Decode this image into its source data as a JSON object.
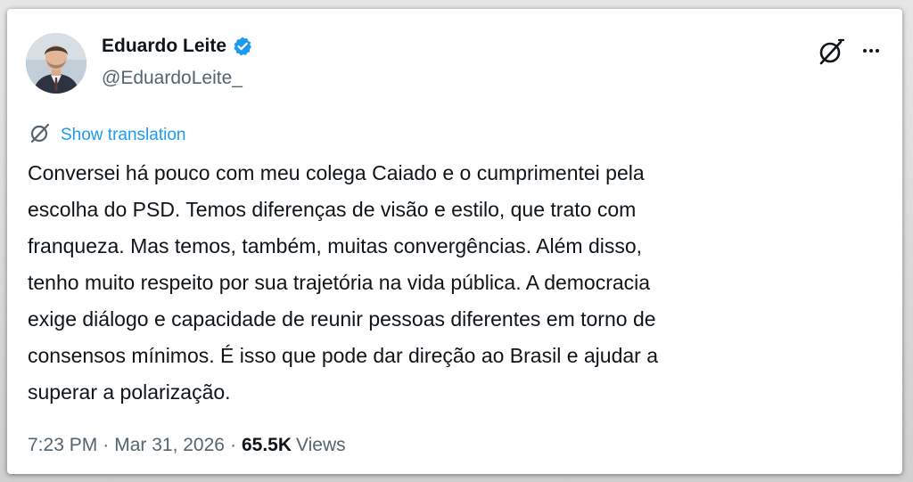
{
  "author": {
    "name": "Eduardo Leite",
    "handle": "@EduardoLeite_",
    "verified_icon": "verified-badge-icon",
    "verified_color": "#1d9bf0"
  },
  "actions": {
    "grok_icon": "grok-icon",
    "more_icon": "more-options-icon"
  },
  "translation": {
    "icon": "translate-icon",
    "label": "Show translation"
  },
  "tweet": {
    "text": "Conversei há pouco com meu colega Caiado e o cumprimentei pela\nescolha do PSD. Temos diferenças de visão e estilo, que trato com\nfranqueza. Mas temos, também, muitas convergências. Além disso,\ntenho muito respeito por sua trajetória na vida pública. A democracia\nexige diálogo e capacidade de reunir pessoas diferentes em torno de\nconsensos mínimos. É isso que pode dar direção ao Brasil e ajudar a\nsuperar a polarização."
  },
  "meta": {
    "time": "7:23 PM",
    "separator": "·",
    "date": "Mar 31, 2026",
    "views_count": "65.5K",
    "views_label": "Views"
  },
  "colors": {
    "text_primary": "#0f1419",
    "text_secondary": "#536471",
    "link": "#1d9bf0",
    "background": "#ffffff"
  }
}
